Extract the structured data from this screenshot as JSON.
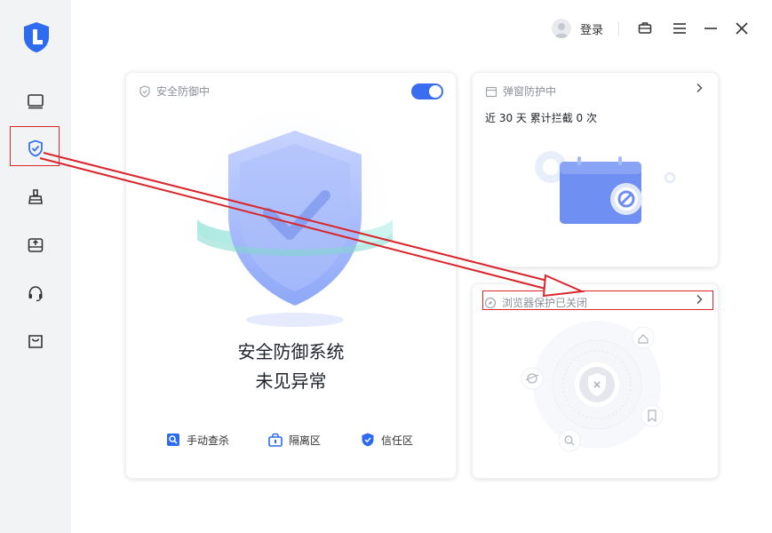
{
  "sidebar": {
    "items": [
      {
        "name": "monitor-icon"
      },
      {
        "name": "shield-check-icon",
        "active": true
      },
      {
        "name": "broom-icon"
      },
      {
        "name": "drive-icon"
      },
      {
        "name": "headset-icon"
      },
      {
        "name": "box-icon"
      }
    ]
  },
  "titlebar": {
    "login_label": "登录",
    "icons": [
      "briefcase-icon",
      "menu-icon",
      "minimize-icon",
      "close-icon"
    ]
  },
  "protection_card": {
    "header_label": "安全防御中",
    "toggle_on": true,
    "status_line1": "安全防御系统",
    "status_line2": "未见异常",
    "tools": [
      {
        "label": "手动查杀",
        "icon": "scan-icon"
      },
      {
        "label": "隔离区",
        "icon": "lock-box-icon"
      },
      {
        "label": "信任区",
        "icon": "shield-icon"
      }
    ]
  },
  "popup_card": {
    "header_label": "弹窗防护中",
    "stat_text": "近 30 天 累计拦截 0 次"
  },
  "browser_card": {
    "header_label": "浏览器保护已关闭"
  },
  "colors": {
    "accent": "#3a6df0",
    "annotation_red": "#d9262c"
  }
}
